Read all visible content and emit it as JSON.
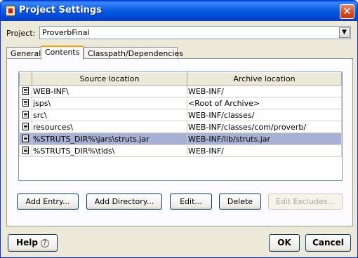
{
  "window": {
    "title": "Project Settings",
    "close_glyph": "✕"
  },
  "project": {
    "label": "Project:",
    "value": "ProverbFinal",
    "arrow_glyph": "▼"
  },
  "tabs": [
    {
      "label": "General"
    },
    {
      "label": "Contents"
    },
    {
      "label": "Classpath/Dependencies"
    }
  ],
  "table": {
    "columns": [
      "Source location",
      "Archive location"
    ],
    "rows": [
      {
        "source": "WEB-INF\\",
        "archive": "WEB-INF/"
      },
      {
        "source": "jsps\\",
        "archive": "<Root of Archive>"
      },
      {
        "source": "src\\",
        "archive": "WEB-INF/classes/"
      },
      {
        "source": "resources\\",
        "archive": "WEB-INF/classes/com/proverb/"
      },
      {
        "source": "%STRUTS_DIR%\\jars\\struts.jar",
        "archive": "WEB-INF/lib/struts.jar"
      },
      {
        "source": "%STRUTS_DIR%\\tlds\\",
        "archive": "WEB-INF/"
      }
    ],
    "selected_row": 4,
    "row_icon": "document-icon"
  },
  "buttons": {
    "add_entry": "Add Entry...",
    "add_directory": "Add Directory...",
    "edit": "Edit...",
    "delete": "Delete",
    "edit_excludes": "Edit Excludes..."
  },
  "footer": {
    "help": "Help",
    "help_glyph": "?",
    "ok": "OK",
    "cancel": "Cancel"
  },
  "colors": {
    "titlebar": "#0a5fe5",
    "selection": "#a6b1d4",
    "dialog_bg": "#ece9d8"
  }
}
